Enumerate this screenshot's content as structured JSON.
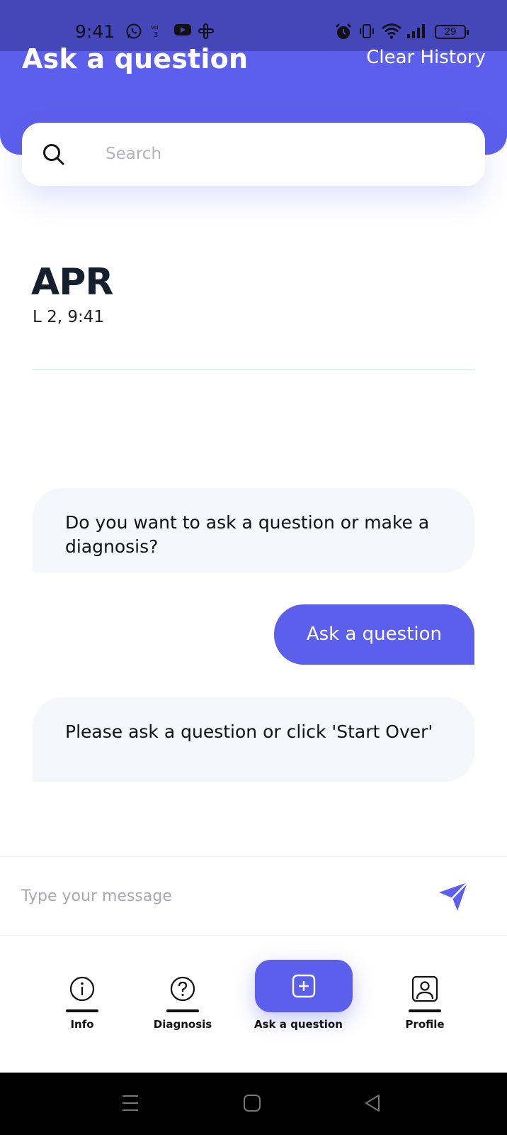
{
  "status_bar": {
    "time": "9:41",
    "battery": "29"
  },
  "header": {
    "title": "Ask a question",
    "clear_history": "Clear History"
  },
  "search": {
    "placeholder": "Search"
  },
  "date": {
    "month": "APR",
    "detail": "L 2,  9:41"
  },
  "messages": [
    {
      "sender": "bot",
      "text": "Do you want to ask a question or make a diagnosis?"
    },
    {
      "sender": "user",
      "text": "Ask a question"
    },
    {
      "sender": "bot",
      "text": "Please ask a question or click 'Start Over'"
    }
  ],
  "composer": {
    "placeholder": "Type your message",
    "send_icon": "send-icon"
  },
  "nav": {
    "items": [
      {
        "label": "Info",
        "icon": "info-icon"
      },
      {
        "label": "Diagnosis",
        "icon": "question-icon"
      },
      {
        "label": "Ask a question",
        "icon": "plus-square-icon"
      },
      {
        "label": "Profile",
        "icon": "profile-icon"
      }
    ]
  },
  "colors": {
    "accent": "#5c5fec",
    "status_bar": "#4546b8",
    "bubble_bot": "#f5f7fc",
    "text_dark": "#14202e"
  }
}
